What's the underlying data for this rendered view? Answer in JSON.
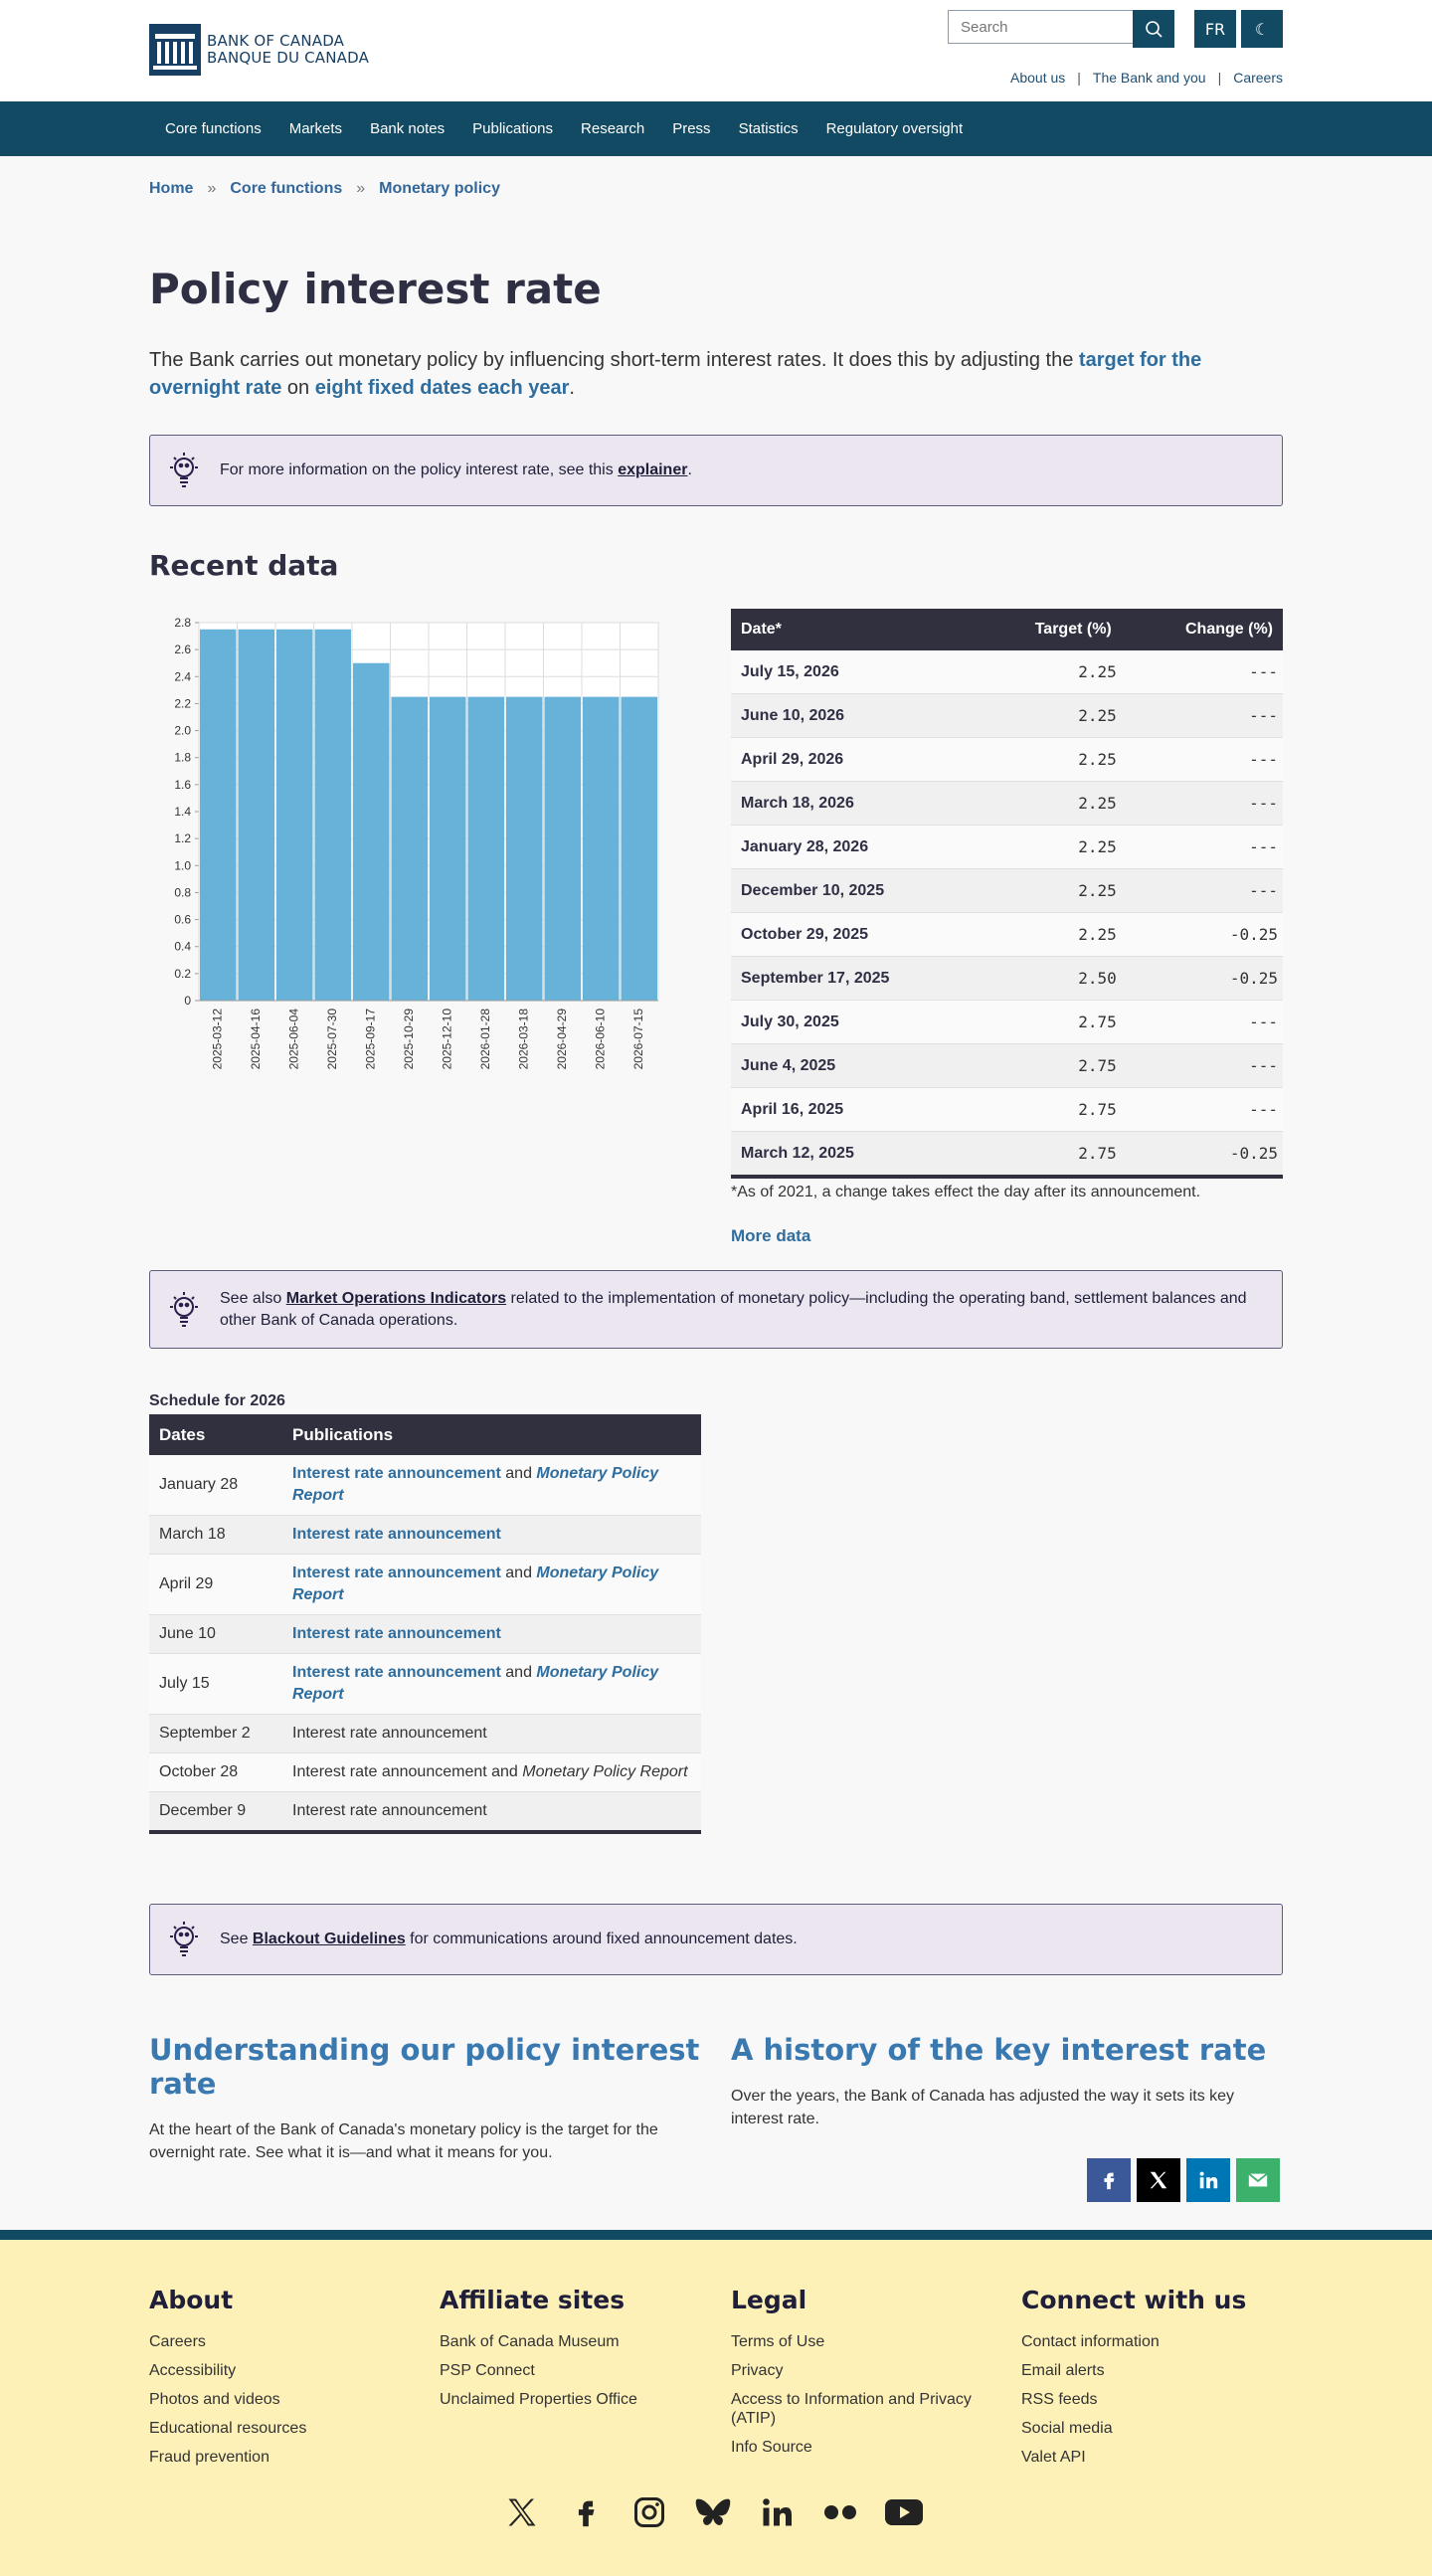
{
  "header": {
    "logo_en": "BANK OF CANADA",
    "logo_fr": "BANQUE DU CANADA",
    "search_placeholder": "Search",
    "lang_button": "FR",
    "top_links": [
      "About us",
      "The Bank and you",
      "Careers"
    ],
    "link_separator": "|"
  },
  "nav": [
    "Core functions",
    "Markets",
    "Bank notes",
    "Publications",
    "Research",
    "Press",
    "Statistics",
    "Regulatory oversight"
  ],
  "breadcrumb": {
    "items": [
      "Home",
      "Core functions",
      "Monetary policy"
    ],
    "separator": "»"
  },
  "page_title": "Policy interest rate",
  "lead": {
    "p1": "The Bank carries out monetary policy by influencing short-term interest rates. It does this by adjusting the ",
    "link1": "target for the overnight rate",
    "p2": " on ",
    "link2": "eight fixed dates each year",
    "p3": "."
  },
  "info1": {
    "text": "For more information on the policy interest rate, see this ",
    "link": "explainer",
    "end": "."
  },
  "recent_heading": "Recent data",
  "chart_data": {
    "type": "bar",
    "categories": [
      "2025-03-12",
      "2025-04-16",
      "2025-06-04",
      "2025-07-30",
      "2025-09-17",
      "2025-10-29",
      "2025-12-10",
      "2026-01-28",
      "2026-03-18",
      "2026-04-29",
      "2026-06-10",
      "2026-07-15"
    ],
    "values": [
      2.75,
      2.75,
      2.75,
      2.75,
      2.5,
      2.25,
      2.25,
      2.25,
      2.25,
      2.25,
      2.25,
      2.25
    ],
    "ylim": [
      0,
      2.8
    ],
    "yticks": [
      "0",
      "0.2",
      "0.4",
      "0.6",
      "0.8",
      "1.0",
      "1.2",
      "1.4",
      "1.6",
      "1.8",
      "2.0",
      "2.2",
      "2.4",
      "2.6",
      "2.8"
    ],
    "grid": true,
    "bar_color": "#66b2d9"
  },
  "rates_table": {
    "headers": [
      "Date*",
      "Target (%)",
      "Change (%)"
    ],
    "rows": [
      [
        "July 15, 2026",
        "2.25",
        "---"
      ],
      [
        "June 10, 2026",
        "2.25",
        "---"
      ],
      [
        "April 29, 2026",
        "2.25",
        "---"
      ],
      [
        "March 18, 2026",
        "2.25",
        "---"
      ],
      [
        "January 28, 2026",
        "2.25",
        "---"
      ],
      [
        "December 10, 2025",
        "2.25",
        "---"
      ],
      [
        "October 29, 2025",
        "2.25",
        "-0.25"
      ],
      [
        "September 17, 2025",
        "2.50",
        "-0.25"
      ],
      [
        "July 30, 2025",
        "2.75",
        "---"
      ],
      [
        "June 4, 2025",
        "2.75",
        "---"
      ],
      [
        "April 16, 2025",
        "2.75",
        "---"
      ],
      [
        "March 12, 2025",
        "2.75",
        "-0.25"
      ]
    ]
  },
  "table_note": "*As of 2021, a change takes effect the day after its announcement.",
  "more_data": "More data",
  "info2": {
    "pre": "See also ",
    "link": "Market Operations Indicators",
    "post": " related to the implementation of monetary policy—including the operating band, settlement balances and other Bank of Canada operations."
  },
  "schedule": {
    "caption": "Schedule for 2026",
    "headers": [
      "Dates",
      "Publications"
    ],
    "ira": "Interest rate announcement",
    "and": " and ",
    "mpr": "Monetary Policy Report",
    "rows": [
      {
        "date": "January 28",
        "mpr": true,
        "link": true
      },
      {
        "date": "March 18",
        "mpr": false,
        "link": true
      },
      {
        "date": "April 29",
        "mpr": true,
        "link": true
      },
      {
        "date": "June 10",
        "mpr": false,
        "link": true
      },
      {
        "date": "July 15",
        "mpr": true,
        "link": true
      },
      {
        "date": "September 2",
        "mpr": false,
        "link": false
      },
      {
        "date": "October 28",
        "mpr": true,
        "link": false
      },
      {
        "date": "December 9",
        "mpr": false,
        "link": false
      }
    ]
  },
  "info3": {
    "pre": "See ",
    "link": "Blackout Guidelines",
    "post": " for communications around fixed announcement dates."
  },
  "features": [
    {
      "title": "Understanding our policy interest rate",
      "text": "At the heart of the Bank of Canada's monetary policy is the target for the overnight rate. See what it is—and what it means for you."
    },
    {
      "title": "A history of the key interest rate",
      "text": "Over the years, the Bank of Canada has adjusted the way it sets its key interest rate."
    }
  ],
  "share_icons": [
    "facebook-icon",
    "x-icon",
    "linkedin-icon",
    "email-icon"
  ],
  "footer": {
    "columns": [
      {
        "title": "About",
        "links": [
          "Careers",
          "Accessibility",
          "Photos and videos",
          "Educational resources",
          "Fraud prevention"
        ]
      },
      {
        "title": "Affiliate sites",
        "links": [
          "Bank of Canada Museum",
          "PSP Connect",
          "Unclaimed Properties Office"
        ]
      },
      {
        "title": "Legal",
        "links": [
          "Terms of Use",
          "Privacy",
          "Access to Information and Privacy (ATIP)",
          "Info Source"
        ]
      },
      {
        "title": "Connect with us",
        "links": [
          "Contact information",
          "Email alerts",
          "RSS feeds",
          "Social media",
          "Valet API"
        ]
      }
    ],
    "social_icons": [
      "x-icon",
      "facebook-icon",
      "instagram-icon",
      "bluesky-icon",
      "linkedin-icon",
      "flickr-icon",
      "youtube-icon"
    ]
  },
  "colors": {
    "brand": "#134a63",
    "link": "#2e6d9e",
    "table_header": "#30303f",
    "footer_bg": "#fdf1b8",
    "info_bg": "#ebe6f0"
  }
}
